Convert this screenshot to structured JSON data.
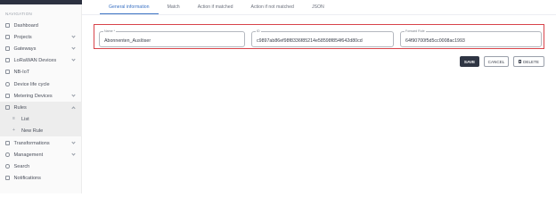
{
  "sidebar": {
    "heading": "NAVIGATION",
    "items": [
      {
        "label": "Dashboard",
        "icon": "dashboard-icon"
      },
      {
        "label": "Projects",
        "icon": "projects-icon"
      },
      {
        "label": "Gateways",
        "icon": "gateways-icon"
      },
      {
        "label": "LoRaWAN Devices",
        "icon": "lorawan-icon"
      },
      {
        "label": "NB-IoT",
        "icon": "nbiot-icon"
      },
      {
        "label": "Device life cycle",
        "icon": "lifecycle-icon"
      },
      {
        "label": "Metering Devices",
        "icon": "metering-icon"
      },
      {
        "label": "Rules",
        "icon": "rules-icon"
      },
      {
        "label": "List",
        "icon": "list-icon"
      },
      {
        "label": "New Rule",
        "icon": "plus-icon"
      },
      {
        "label": "Transformations",
        "icon": "transformations-icon"
      },
      {
        "label": "Management",
        "icon": "management-icon"
      },
      {
        "label": "Search",
        "icon": "search-icon"
      },
      {
        "label": "Notifications",
        "icon": "bell-icon"
      }
    ]
  },
  "tabs": [
    "General information",
    "Match",
    "Action if matched",
    "Action if not matched",
    "JSON"
  ],
  "form": {
    "name_label": "Name *",
    "name_value": "Abonnenten_Auslöser",
    "id_label": "ID",
    "id_value": "c9897ab86ef98f8336f85214e58598f854f642d80cd",
    "fw_label": "Forward Rule",
    "fw_value": "64f90700f5d5cc0008ac1993"
  },
  "actions": {
    "save": "SAVE",
    "cancel": "CANCEL",
    "delete": "DELETE"
  }
}
